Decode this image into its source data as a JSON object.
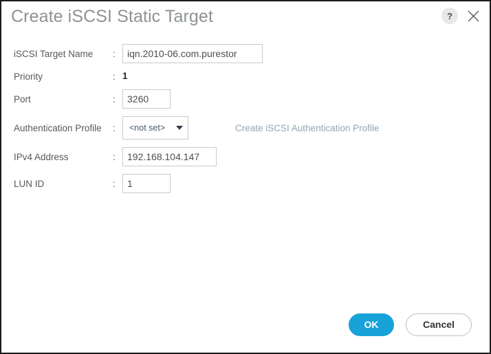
{
  "dialog": {
    "title": "Create iSCSI Static Target",
    "help_icon_label": "?",
    "help_icon_name": "help-icon",
    "close_icon_name": "close-icon",
    "accent_color": "#17a2d8",
    "title_color": "#8e9295",
    "link_color": "#93a6b3"
  },
  "form": {
    "colon": ":",
    "rows": [
      {
        "label": "iSCSI Target Name",
        "type": "text-input",
        "value": "iqn.2010-06.com.purestor",
        "placeholder": ""
      },
      {
        "label": "Priority",
        "type": "static",
        "value": "1"
      },
      {
        "label": "Port",
        "type": "text-input",
        "value": "3260",
        "placeholder": ""
      },
      {
        "label": "Authentication Profile",
        "type": "select",
        "value": "<not set>",
        "options": [
          "<not set>"
        ],
        "side_link": "Create iSCSI Authentication Profile"
      },
      {
        "label": "IPv4 Address",
        "type": "text-input",
        "value": "192.168.104.147",
        "placeholder": ""
      },
      {
        "label": "LUN ID",
        "type": "text-input",
        "value": "1",
        "placeholder": ""
      }
    ]
  },
  "footer": {
    "ok_label": "OK",
    "cancel_label": "Cancel"
  }
}
